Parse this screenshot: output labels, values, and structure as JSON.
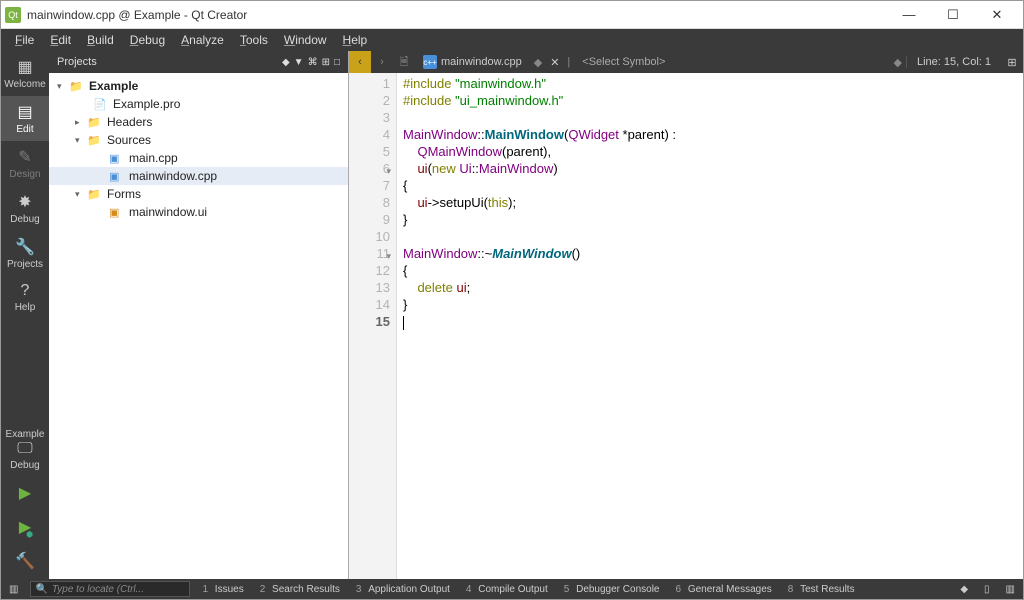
{
  "titlebar": {
    "title": "mainwindow.cpp @ Example - Qt Creator"
  },
  "menu": [
    "File",
    "Edit",
    "Build",
    "Debug",
    "Analyze",
    "Tools",
    "Window",
    "Help"
  ],
  "modebar": [
    {
      "label": "Welcome",
      "icon": "⊞"
    },
    {
      "label": "Edit",
      "icon": "≡",
      "active": true
    },
    {
      "label": "Design",
      "icon": "✎",
      "dim": true
    },
    {
      "label": "Debug",
      "icon": "🐞"
    },
    {
      "label": "Projects",
      "icon": "🔧"
    },
    {
      "label": "Help",
      "icon": "?"
    }
  ],
  "kit": {
    "project": "Example",
    "config": "Debug"
  },
  "projects_header": "Projects",
  "tree": {
    "root": "Example",
    "pro": "Example.pro",
    "headers": "Headers",
    "sources": "Sources",
    "main": "main.cpp",
    "mw": "mainwindow.cpp",
    "forms": "Forms",
    "ui": "mainwindow.ui"
  },
  "edbar": {
    "file": "mainwindow.cpp",
    "symbol": "<Select Symbol>",
    "pos": "Line: 15, Col: 1"
  },
  "code": {
    "lines": 15
  },
  "status": {
    "locator": "Type to locate (Ctrl...",
    "tabs": [
      {
        "n": "1",
        "t": "Issues"
      },
      {
        "n": "2",
        "t": "Search Results"
      },
      {
        "n": "3",
        "t": "Application Output"
      },
      {
        "n": "4",
        "t": "Compile Output"
      },
      {
        "n": "5",
        "t": "Debugger Console"
      },
      {
        "n": "6",
        "t": "General Messages"
      },
      {
        "n": "8",
        "t": "Test Results"
      }
    ]
  }
}
